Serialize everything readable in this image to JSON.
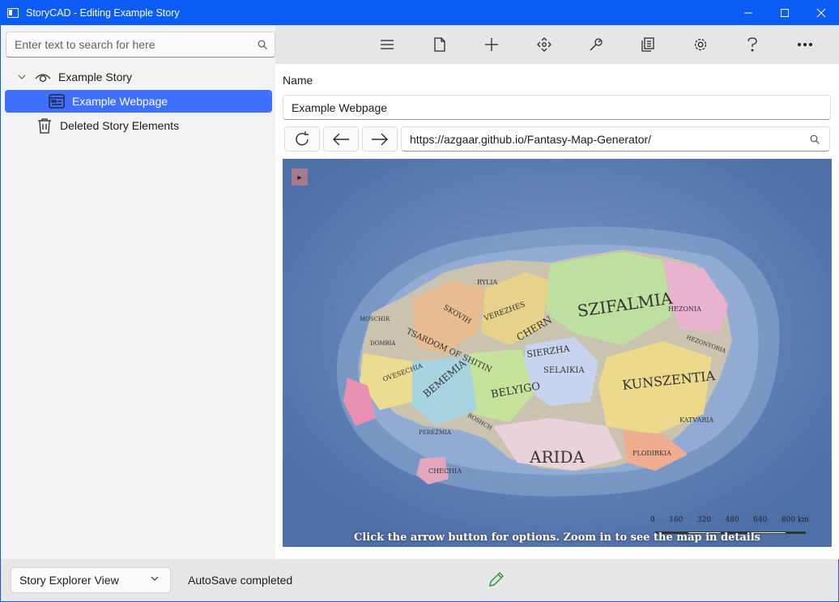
{
  "window": {
    "title": "StoryCAD - Editing Example Story",
    "controls": [
      "minimize-icon",
      "maximize-icon",
      "close-icon"
    ]
  },
  "search": {
    "placeholder": "Enter text to search for here"
  },
  "tree": {
    "items": [
      {
        "label": "Example Story",
        "icon": "eye-icon",
        "expanded": true,
        "selected": false
      },
      {
        "label": "Example Webpage",
        "icon": "webpage-icon",
        "selected": true
      },
      {
        "label": "Deleted Story Elements",
        "icon": "trash-icon",
        "selected": false
      }
    ]
  },
  "toolbar": {
    "buttons": [
      "menu-icon",
      "new-file-icon",
      "add-icon",
      "move-icon",
      "tools-icon",
      "reports-icon",
      "settings-icon",
      "help-icon",
      "more-icon"
    ]
  },
  "form": {
    "name_label": "Name",
    "name_value": "Example Webpage",
    "url_value": "https://azgaar.github.io/Fantasy-Map-Generator/"
  },
  "map": {
    "toggle_glyph": "►",
    "caption": "Click the arrow button for options. Zoom in to see the map in details",
    "scale_ticks": [
      "0",
      "160",
      "320",
      "480",
      "640",
      "800 km"
    ],
    "regions": [
      "SZIFALMIA",
      "KUNSZENTIA",
      "ARIDA",
      "BELYIGO",
      "BEMEMIA",
      "TSARDOM OF SHITIN",
      "SKOVIH",
      "VEREZHES",
      "CHERN",
      "SIERZHA",
      "SELAIKIA",
      "HEZONIA",
      "HEZONYORIA",
      "RYLIA",
      "OVESECHIA",
      "KATVARIA",
      "FLODIRKIA",
      "CHECHIA",
      "PEREZMIA",
      "ROSHCH",
      "MOSCHIR",
      "DOMBIA"
    ]
  },
  "status": {
    "view_select": "Story Explorer View",
    "message": "AutoSave completed"
  },
  "colors": {
    "accent": "#0b5cf5",
    "selection": "#4070ff",
    "edit_icon": "#2e9b3e"
  }
}
